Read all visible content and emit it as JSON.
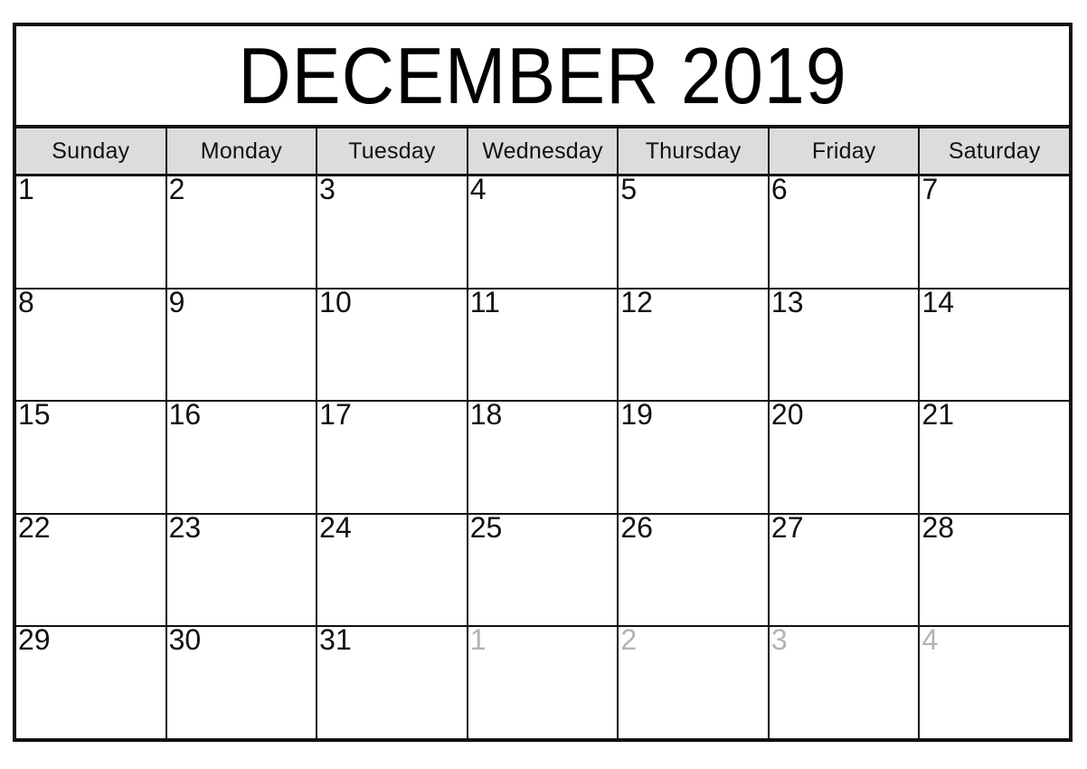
{
  "document": {
    "type": "monthly-calendar",
    "title": "DECEMBER 2019",
    "month": "DECEMBER",
    "year": "2019"
  },
  "colors": {
    "frame_border": "#111111",
    "header_background": "#dcdcdc",
    "page_background": "#ffffff",
    "current_month_text": "#111111",
    "other_month_text": "#b3b3b3"
  },
  "weekdays": [
    {
      "label": "Sunday"
    },
    {
      "label": "Monday"
    },
    {
      "label": "Tuesday"
    },
    {
      "label": "Wednesday"
    },
    {
      "label": "Thursday"
    },
    {
      "label": "Friday"
    },
    {
      "label": "Saturday"
    }
  ],
  "weeks": [
    {
      "days": [
        {
          "number": "1",
          "other_month": false
        },
        {
          "number": "2",
          "other_month": false
        },
        {
          "number": "3",
          "other_month": false
        },
        {
          "number": "4",
          "other_month": false
        },
        {
          "number": "5",
          "other_month": false
        },
        {
          "number": "6",
          "other_month": false
        },
        {
          "number": "7",
          "other_month": false
        }
      ]
    },
    {
      "days": [
        {
          "number": "8",
          "other_month": false
        },
        {
          "number": "9",
          "other_month": false
        },
        {
          "number": "10",
          "other_month": false
        },
        {
          "number": "11",
          "other_month": false
        },
        {
          "number": "12",
          "other_month": false
        },
        {
          "number": "13",
          "other_month": false
        },
        {
          "number": "14",
          "other_month": false
        }
      ]
    },
    {
      "days": [
        {
          "number": "15",
          "other_month": false
        },
        {
          "number": "16",
          "other_month": false
        },
        {
          "number": "17",
          "other_month": false
        },
        {
          "number": "18",
          "other_month": false
        },
        {
          "number": "19",
          "other_month": false
        },
        {
          "number": "20",
          "other_month": false
        },
        {
          "number": "21",
          "other_month": false
        }
      ]
    },
    {
      "days": [
        {
          "number": "22",
          "other_month": false
        },
        {
          "number": "23",
          "other_month": false
        },
        {
          "number": "24",
          "other_month": false
        },
        {
          "number": "25",
          "other_month": false
        },
        {
          "number": "26",
          "other_month": false
        },
        {
          "number": "27",
          "other_month": false
        },
        {
          "number": "28",
          "other_month": false
        }
      ]
    },
    {
      "days": [
        {
          "number": "29",
          "other_month": false
        },
        {
          "number": "30",
          "other_month": false
        },
        {
          "number": "31",
          "other_month": false
        },
        {
          "number": "1",
          "other_month": true
        },
        {
          "number": "2",
          "other_month": true
        },
        {
          "number": "3",
          "other_month": true
        },
        {
          "number": "4",
          "other_month": true
        }
      ]
    }
  ]
}
